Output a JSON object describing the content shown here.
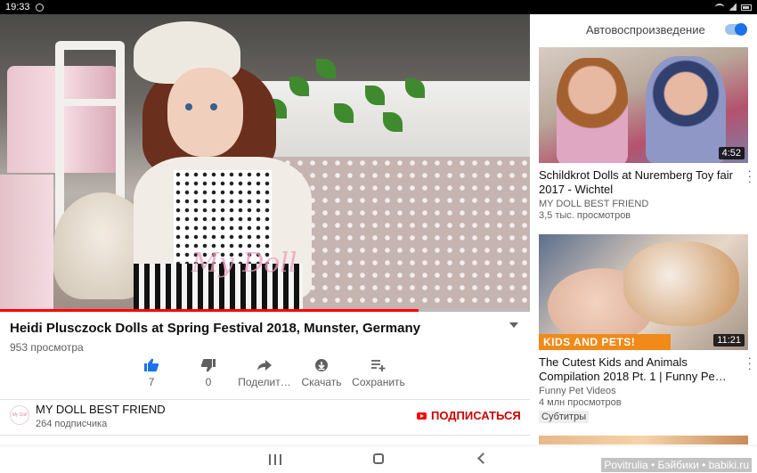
{
  "status_bar": {
    "time": "19:33"
  },
  "player": {
    "watermark": "My Doll",
    "progress": 0.79
  },
  "video": {
    "title": "Heidi Plusczock Dolls at Spring Festival 2018, Munster, Germany",
    "views": "953 просмотра",
    "actions": {
      "like_count": "7",
      "dislike_count": "0",
      "share_label": "Поделит…",
      "download_label": "Скачать",
      "save_label": "Сохранить"
    }
  },
  "channel": {
    "name": "MY DOLL BEST FRIEND",
    "subscribers": "264 подписчика",
    "avatar_text": "My Doll",
    "subscribe_label": "ПОДПИСАТЬСЯ"
  },
  "sidebar": {
    "autoplay_label": "Автовоспроизведение",
    "autoplay_on": true,
    "recommendations": [
      {
        "title": "Schildkrot Dolls at Nuremberg Toy fair 2017 - Wichtel",
        "channel": "MY DOLL BEST FRIEND",
        "views": "3,5 тыс. просмотров",
        "duration": "4:52"
      },
      {
        "title": "The Cutest Kids and Animals Compilation 2018 Pt. 1 | Funny Pe…",
        "channel": "Funny Pet Videos",
        "views": "4 млн просмотров",
        "duration": "11:21",
        "thumb_banner": "KIDS AND PETS!",
        "badge": "Субтитры"
      }
    ]
  },
  "credit": "Povitrulia • Бэйбики • babiki.ru",
  "colors": {
    "accent_red": "#cc0000",
    "progress_red": "#ff0000",
    "toggle_blue": "#1a73e8",
    "like_blue": "#1a73e8"
  }
}
